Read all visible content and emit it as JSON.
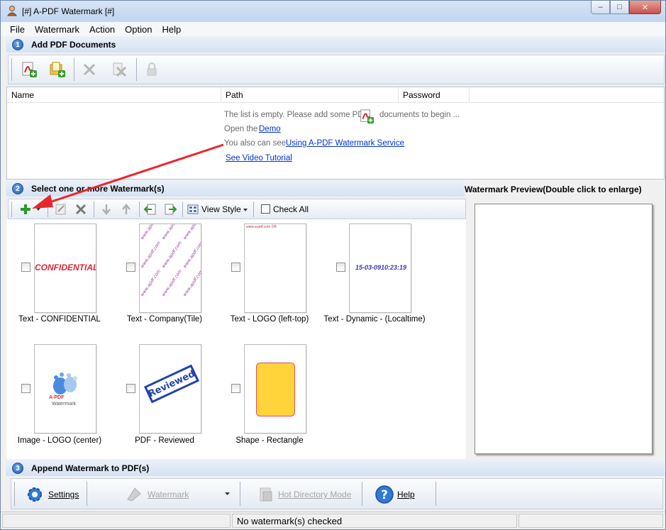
{
  "window": {
    "title": "[#] A-PDF Watermark [#]",
    "min": "–",
    "max": "□",
    "close": "✕"
  },
  "menu": [
    "File",
    "Watermark",
    "Action",
    "Option",
    "Help"
  ],
  "section1": {
    "num": "1",
    "title": "Add PDF Documents"
  },
  "filelist": {
    "columns": [
      "Name",
      "Path",
      "Password"
    ],
    "empty_hint_a": "The list is empty. Please add some PDF",
    "empty_hint_b": "documents to begin ...",
    "open_the": "Open the",
    "demo_link": "Demo",
    "also_see": "You also can see",
    "service_link": "Using A-PDF Watermark Service",
    "video_link": "See Video Tutorial"
  },
  "section2": {
    "num": "2",
    "title": "Select one or more Watermark(s)"
  },
  "wm_toolbar": {
    "view_style": "View Style",
    "check_all": "Check All"
  },
  "watermarks": [
    {
      "label": "Text - CONFIDENTIAL",
      "thumb_text": "CONFIDENTIAL"
    },
    {
      "label": "Text - Company(Tile)",
      "thumb_text": "www.apdf.com"
    },
    {
      "label": "Text - LOGO (left-top)",
      "thumb_text": "www.a-pdf.com ©®"
    },
    {
      "label": "Text - Dynamic - (Localtime)",
      "thumb_text": "15-03-0910:23:19"
    },
    {
      "label": "Image - LOGO (center)",
      "thumb_text": "A-PDF",
      "thumb_text2": "Watermark"
    },
    {
      "label": "PDF - Reviewed",
      "thumb_text": "Reviewed"
    },
    {
      "label": "Shape - Rectangle",
      "thumb_text": ""
    }
  ],
  "preview": {
    "title": "Watermark Preview(Double click to enlarge)"
  },
  "section3": {
    "num": "3",
    "title": "Append Watermark to PDF(s)"
  },
  "bottom": {
    "settings": "Settings",
    "watermark": "Watermark",
    "hot_dir": "Hot Directory Mode",
    "help": "Help"
  },
  "status": {
    "message": "No watermark(s) checked"
  },
  "colors": {
    "accent": "#1e5aaa",
    "confidential": "#d8283a",
    "dynamic": "#3a35b0",
    "reviewed": "#2144a8",
    "rect_fill": "#ffd33a",
    "rect_border": "#e05050"
  }
}
